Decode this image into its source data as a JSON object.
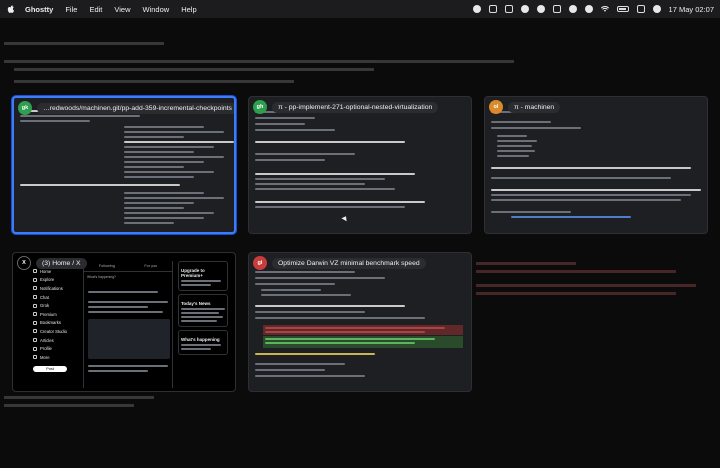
{
  "menubar": {
    "app_name": "Ghostty",
    "items": [
      "File",
      "Edit",
      "View",
      "Window",
      "Help"
    ],
    "clock": "17 May  02:07"
  },
  "windows": [
    {
      "badge": "gk",
      "badge_color": "#2e9e4f",
      "title": "…redwoods/machinen.git/pp-add-359-incremental-checkpoints",
      "selected": true
    },
    {
      "badge": "gh",
      "badge_color": "#2e9e4f",
      "title": "π - pp-implement-271-optional-nested-virtualization",
      "selected": false
    },
    {
      "badge": "ol",
      "badge_color": "#d98b2b",
      "title": "π - machinen",
      "selected": false
    },
    {
      "badge": "X",
      "badge_color": "#000000",
      "title": "(3) Home / X",
      "selected": false
    },
    {
      "badge": "gi",
      "badge_color": "#c93c3c",
      "title": "Optimize Darwin VZ minimal benchmark speed",
      "selected": false
    }
  ],
  "twitter": {
    "nav": [
      "Home",
      "Explore",
      "Notifications",
      "Chat",
      "Grok",
      "Premium",
      "Bookmarks",
      "Creator Studio",
      "Articles",
      "Profile",
      "More"
    ],
    "post_label": "Post",
    "tabs": [
      "Following",
      "For you"
    ],
    "compose_placeholder": "What's happening?",
    "right_heading_1": "Upgrade to Premium+",
    "right_heading_2": "Today's News",
    "right_heading_3": "What's happening"
  }
}
